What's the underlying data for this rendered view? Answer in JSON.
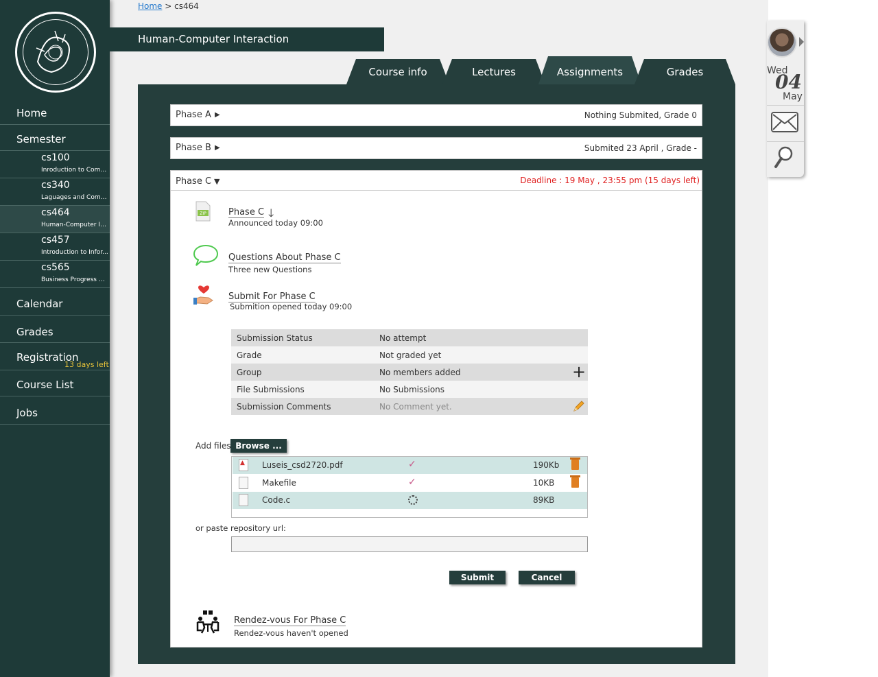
{
  "breadcrumb": {
    "home": "Home",
    "separator": ">",
    "current": "cs464"
  },
  "course_title": "Human-Computer Interaction",
  "sidebar": {
    "home": "Home",
    "semester": "Semester",
    "courses": [
      {
        "code": "cs100",
        "name": "Inroduction to Comp..."
      },
      {
        "code": "cs340",
        "name": "Laguages and Compi..."
      },
      {
        "code": "cs464",
        "name": "Human-Computer In..."
      },
      {
        "code": "cs457",
        "name": "Introduction to Infor..."
      },
      {
        "code": "cs565",
        "name": "Business Progress M..."
      }
    ],
    "calendar": "Calendar",
    "grades": "Grades",
    "registration": "Registration",
    "registration_note": "13 days left",
    "course_list": "Course List",
    "jobs": "Jobs"
  },
  "tabs": [
    "Course info",
    "Lectures",
    "Assignments",
    "Grades"
  ],
  "date": {
    "day": "Wed",
    "num": "04",
    "month": "May"
  },
  "phases": {
    "a": {
      "title": "Phase A",
      "status": "Nothing Submited, Grade 0"
    },
    "b": {
      "title": "Phase B",
      "status": "Submited 23 April , Grade -"
    },
    "c": {
      "title": "Phase C",
      "deadline": "Deadline : 19 May , 23:55 pm  (15 days left)"
    }
  },
  "phase_c_items": {
    "file": {
      "title": "Phase C",
      "sub": "Announced today 09:00"
    },
    "questions": {
      "title": "Questions About Phase C",
      "sub": "Three new Questions"
    },
    "submit": {
      "title": "Submit For Phase C",
      "sub": "Submition opened today 09:00"
    },
    "rendezvous": {
      "title": "Rendez-vous For Phase C",
      "sub": "Rendez-vous haven't opened"
    }
  },
  "submission_table": [
    {
      "key": "Submission Status",
      "value": "No attempt"
    },
    {
      "key": "Grade",
      "value": "Not graded yet"
    },
    {
      "key": "Group",
      "value": "No members added"
    },
    {
      "key": "File Submissions",
      "value": "No Submissions"
    },
    {
      "key": "Submission Comments",
      "value": "No Comment yet."
    }
  ],
  "add_files_label": "Add files:",
  "browse_label": "Browse ...",
  "files": [
    {
      "name": "Luseis_csd2720.pdf",
      "size": "190Kb"
    },
    {
      "name": "Makefile",
      "size": "10KB"
    },
    {
      "name": "Code.c",
      "size": "89KB"
    }
  ],
  "repo_label": "or paste repository url:",
  "repo_value": "",
  "submit_label": "Submit",
  "cancel_label": "Cancel",
  "colors": {
    "sidebar": "#1e3a38",
    "panel": "#253e3c",
    "deadline": "#e02020",
    "accent": "#e6c23a"
  }
}
